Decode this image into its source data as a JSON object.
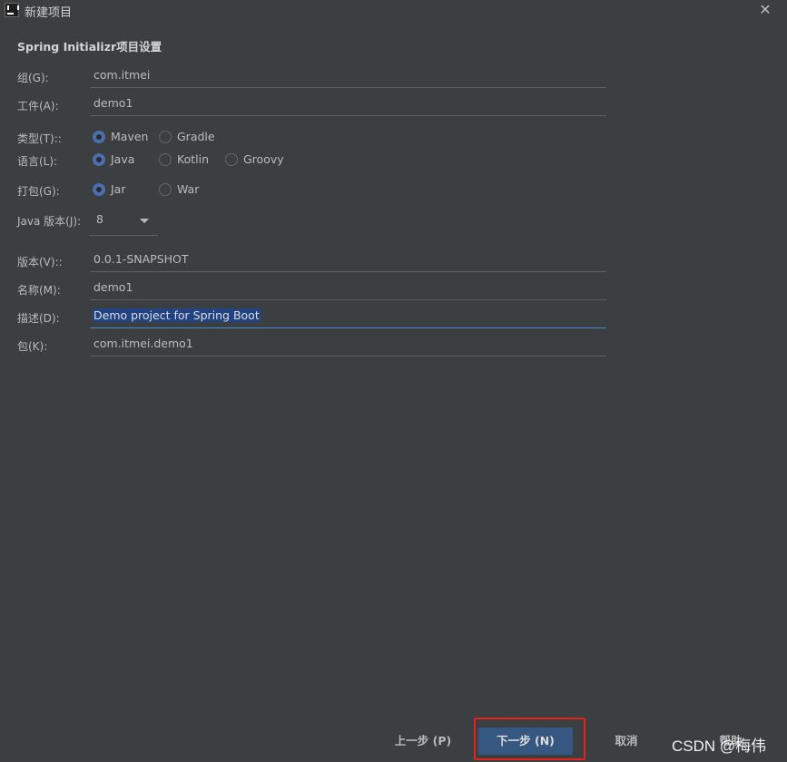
{
  "window": {
    "title": "新建项目"
  },
  "section_title": "Spring Initializr项目设置",
  "fields": {
    "group": {
      "label": "组(G):",
      "value": "com.itmei"
    },
    "artifact": {
      "label": "工件(A):",
      "value": "demo1"
    },
    "version": {
      "label": "版本(V)::",
      "value": "0.0.1-SNAPSHOT"
    },
    "name": {
      "label": "名称(M):",
      "value": "demo1"
    },
    "description": {
      "label": "描述(D):",
      "value": "Demo project for Spring Boot"
    },
    "package": {
      "label": "包(K):",
      "value": "com.itmei.demo1"
    }
  },
  "type": {
    "label": "类型(T)::",
    "options": [
      "Maven",
      "Gradle"
    ],
    "selected": "Maven"
  },
  "language": {
    "label": "语言(L):",
    "options": [
      "Java",
      "Kotlin",
      "Groovy"
    ],
    "selected": "Java"
  },
  "packaging": {
    "label": "打包(G):",
    "options": [
      "Jar",
      "War"
    ],
    "selected": "Jar"
  },
  "java_version": {
    "label": "Java 版本(J):",
    "value": "8"
  },
  "buttons": {
    "previous": "上一步 (P)",
    "next": "下一步 (N)",
    "cancel": "取消",
    "help": "帮助"
  },
  "watermark": "CSDN @梅伟",
  "colors": {
    "background": "#3c3f41",
    "accent": "#365880",
    "highlight_border": "#e8201b",
    "selection": "#214283"
  }
}
